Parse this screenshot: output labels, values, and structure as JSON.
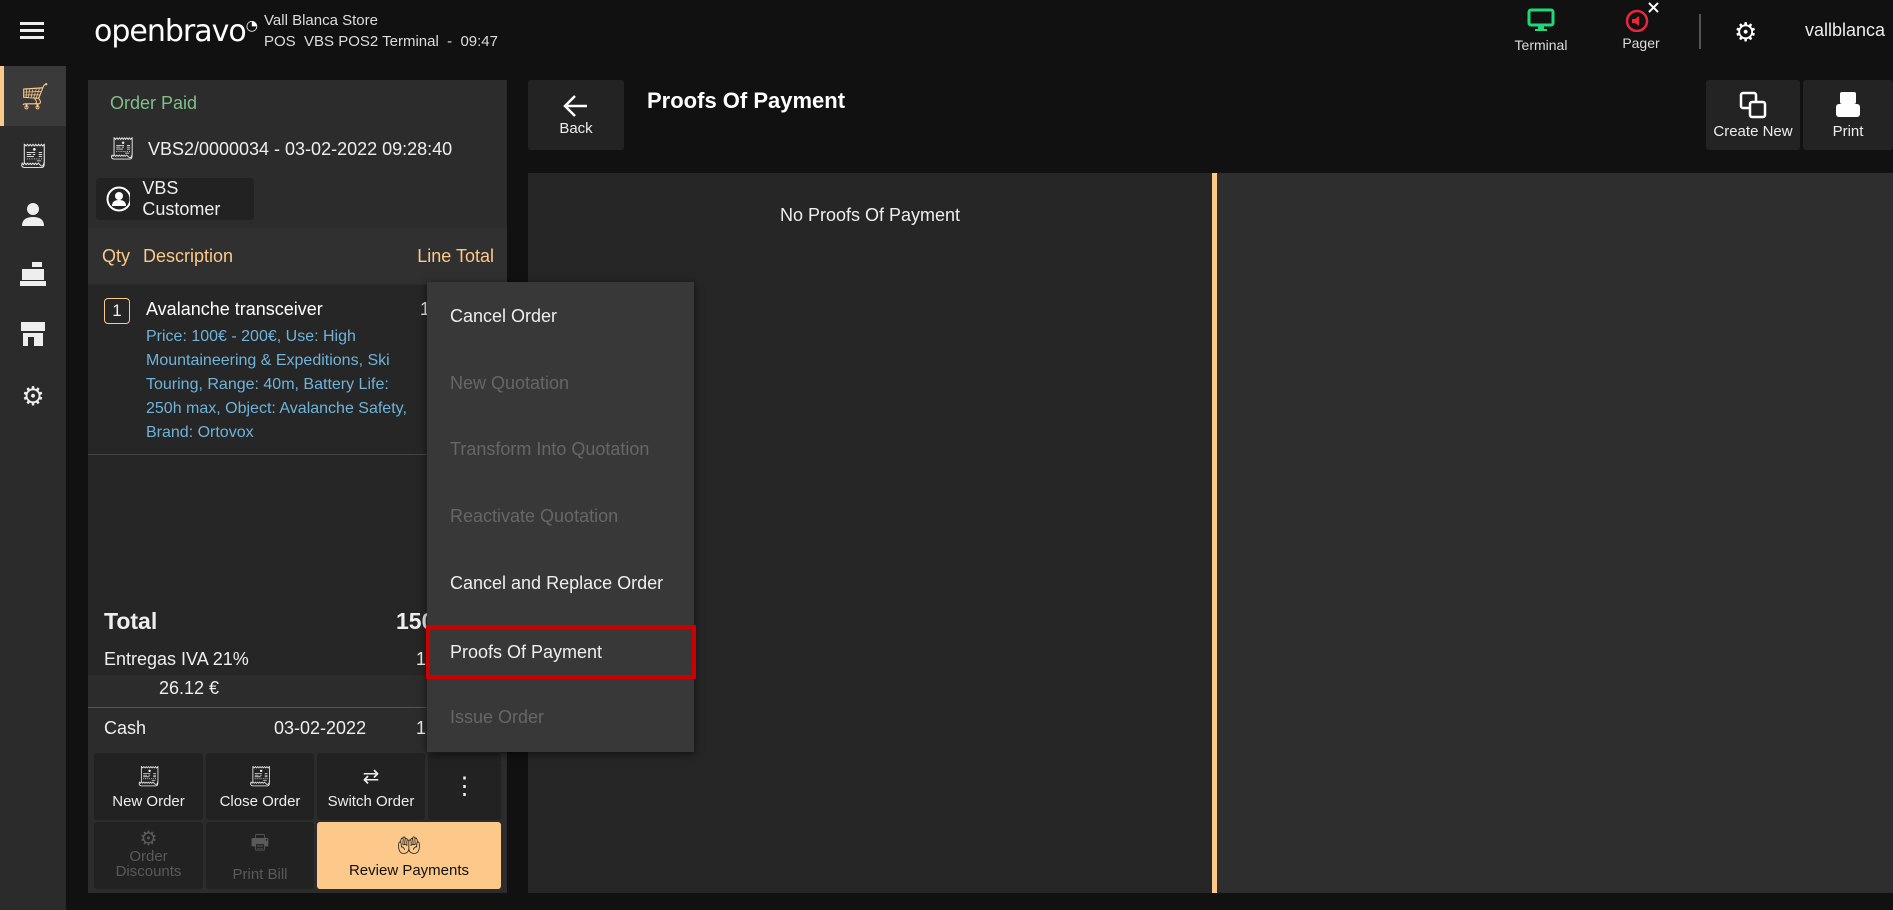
{
  "header": {
    "store": "Vall Blanca Store",
    "terminal_line": "POS  VBS POS2 Terminal  -  09:47",
    "terminal_label": "Terminal",
    "pager_label": "Pager",
    "user": "vallblanca",
    "logo": "openbravo"
  },
  "order": {
    "status": "Order Paid",
    "document": "VBS2/0000034 - 03-02-2022 09:28:40",
    "customer": "VBS Customer",
    "columns": {
      "qty": "Qty",
      "description": "Description",
      "line_total": "Line Total"
    },
    "lines": [
      {
        "qty": "1",
        "name": "Avalanche transceiver",
        "details": "Price: 100€ - 200€, Use: High Mountaineering & Expeditions, Ski Touring, Range: 40m, Battery Life: 250h max, Object: Avalanche Safety, Brand: Ortovox",
        "total": "1"
      }
    ],
    "total_label": "Total",
    "total_value": "150",
    "tax_label": "Entregas IVA 21%",
    "tax_value": "1",
    "tax_amount": "26.12 €",
    "payment": {
      "method": "Cash",
      "date": "03-02-2022",
      "amount": "1"
    }
  },
  "actions": {
    "new_order": "New Order",
    "close_order": "Close Order",
    "switch_order": "Switch Order",
    "order_discounts": "Order Discounts",
    "print_bill": "Print Bill",
    "review_payments": "Review Payments"
  },
  "menu": {
    "items": [
      {
        "label": "Cancel Order",
        "enabled": true
      },
      {
        "label": "New Quotation",
        "enabled": false
      },
      {
        "label": "Transform Into Quotation",
        "enabled": false
      },
      {
        "label": "Reactivate Quotation",
        "enabled": false
      },
      {
        "label": "Cancel and Replace Order",
        "enabled": true
      },
      {
        "label": "Proofs Of Payment",
        "enabled": true,
        "highlighted": true
      },
      {
        "label": "Issue Order",
        "enabled": false
      }
    ]
  },
  "proofs": {
    "back": "Back",
    "title": "Proofs Of Payment",
    "create_new": "Create New",
    "print": "Print",
    "empty": "No Proofs Of Payment"
  },
  "colors": {
    "accent": "#fcc98a",
    "status_green": "#7fbf8a",
    "detail_blue": "#6fb3d9",
    "terminal_green": "#1ed97a",
    "pager_red": "#e8283a",
    "highlight_red": "#cc0000"
  }
}
